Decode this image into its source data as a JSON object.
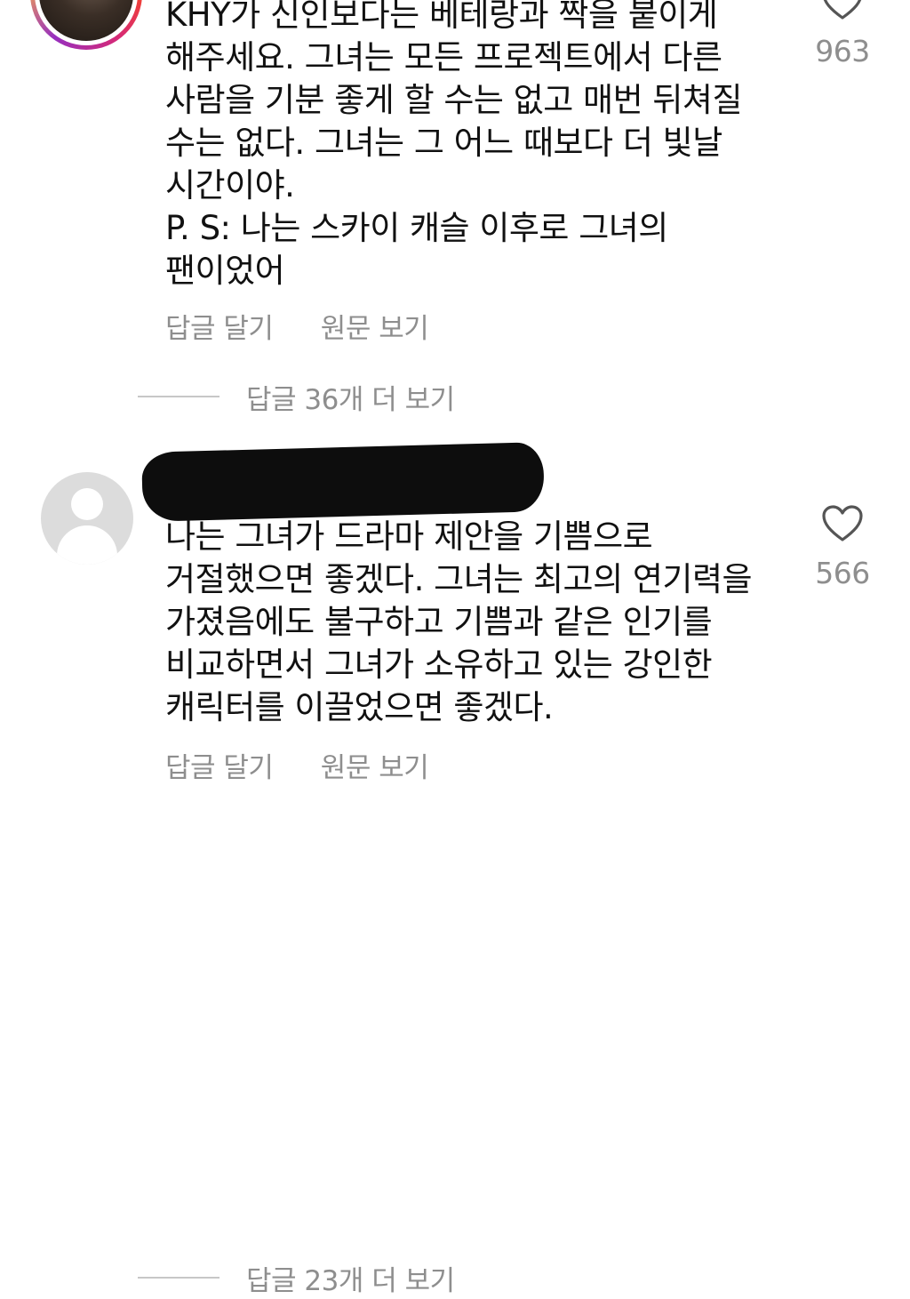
{
  "comments": [
    {
      "text": "KHY가 신인보다는 베테랑과 짝을 붙이게\n해주세요. 그녀는 모든 프로젝트에서 다른\n사람을 기분 좋게 할 수는 없고 매번 뒤쳐질\n수는 없다. 그녀는 그 어느 때보다 더 빛날\n시간이야.\nP. S: 나는 스카이 캐슬 이후로 그녀의\n팬이었어",
      "reply_label": "답글 달기",
      "view_original_label": "원문 보기",
      "like_count": "963",
      "view_replies_label": "답글 36개 더 보기",
      "avatar_icon": "profile-photo-with-story-ring"
    },
    {
      "text": "나는 그녀가 드라마 제안을 기쁨으로\n거절했으면 좋겠다. 그녀는 최고의 연기력을\n가졌음에도 불구하고 기쁨과 같은 인기를\n비교하면서 그녀가 소유하고 있는 강인한\n캐릭터를 이끌었으면 좋겠다.",
      "reply_label": "답글 달기",
      "view_original_label": "원문 보기",
      "like_count": "566",
      "view_replies_label": "답글 23개 더 보기",
      "avatar_icon": "default-avatar-icon"
    }
  ],
  "icons": {
    "like": "heart-outline-icon"
  },
  "colors": {
    "text": "#111111",
    "secondary": "#8e8e8e",
    "divider": "#c7c7c7",
    "redaction": "#0d0d0d"
  }
}
